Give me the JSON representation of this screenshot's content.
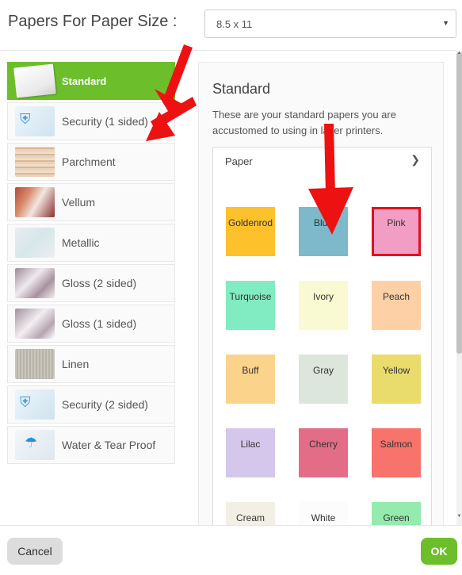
{
  "header": {
    "title": "Papers For Paper Size :",
    "paper_size_value": "8.5 x 11"
  },
  "sidebar": {
    "items": [
      {
        "label": "Standard",
        "icon": "standard-paper-thumbnail",
        "active": true
      },
      {
        "label": "Security (1 sided)",
        "icon": "security-paper-thumbnail",
        "active": false
      },
      {
        "label": "Parchment",
        "icon": "parchment-paper-thumbnail",
        "active": false
      },
      {
        "label": "Vellum",
        "icon": "vellum-paper-thumbnail",
        "active": false
      },
      {
        "label": "Metallic",
        "icon": "metallic-paper-thumbnail",
        "active": false
      },
      {
        "label": "Gloss (2 sided)",
        "icon": "gloss-paper-thumbnail",
        "active": false
      },
      {
        "label": "Gloss (1 sided)",
        "icon": "gloss-paper-thumbnail",
        "active": false
      },
      {
        "label": "Linen",
        "icon": "linen-paper-thumbnail",
        "active": false
      },
      {
        "label": "Security (2 sided)",
        "icon": "security-paper-thumbnail",
        "active": false
      },
      {
        "label": "Water & Tear Proof",
        "icon": "water-tear-proof-thumbnail",
        "active": false
      }
    ]
  },
  "main": {
    "title": "Standard",
    "description": "These are your standard papers you are accustomed to using in laser printers.",
    "dropdown_label": "Paper",
    "colors": [
      {
        "name": "Goldenrod",
        "color": "#fcc12b",
        "selected": false
      },
      {
        "name": "Blue",
        "color": "#7db9cb",
        "selected": false
      },
      {
        "name": "Pink",
        "color": "#f29ec4",
        "selected": true
      },
      {
        "name": "Turquoise",
        "color": "#81ebc2",
        "selected": false
      },
      {
        "name": "Ivory",
        "color": "#fafad2",
        "selected": false
      },
      {
        "name": "Peach",
        "color": "#fed0a6",
        "selected": false
      },
      {
        "name": "Buff",
        "color": "#fbd38b",
        "selected": false
      },
      {
        "name": "Gray",
        "color": "#dde6dd",
        "selected": false
      },
      {
        "name": "Yellow",
        "color": "#e9dc6d",
        "selected": false
      },
      {
        "name": "Lilac",
        "color": "#d5c6ec",
        "selected": false
      },
      {
        "name": "Cherry",
        "color": "#e36d87",
        "selected": false
      },
      {
        "name": "Salmon",
        "color": "#f7736c",
        "selected": false
      },
      {
        "name": "Cream",
        "color": "#f2efe6",
        "selected": false
      },
      {
        "name": "White",
        "color": "#fcfcfc",
        "selected": false
      },
      {
        "name": "Green",
        "color": "#94ebad",
        "selected": false
      }
    ]
  },
  "footer": {
    "cancel_label": "Cancel",
    "ok_label": "OK"
  },
  "colors": {
    "accent_green": "#6cbf2a",
    "selection_red": "#e0101e",
    "annotation_arrow": "#ee1111"
  }
}
